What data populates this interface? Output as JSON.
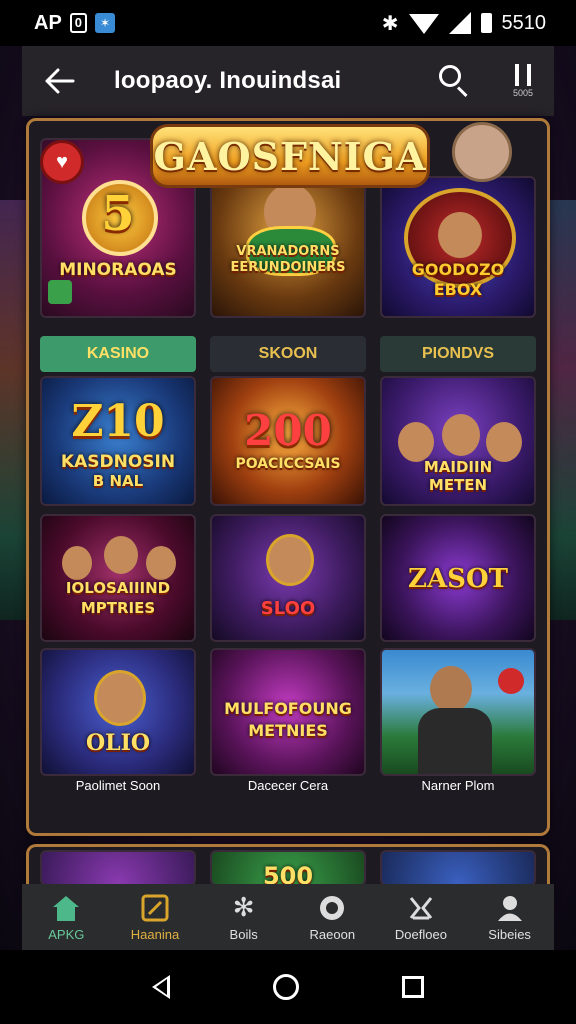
{
  "status_bar": {
    "left_text": "AP",
    "sim_label": "0",
    "bt_label": "✶",
    "time": "5510"
  },
  "header": {
    "title": "loopaoy. Inouindsai",
    "pause_sub": "5005"
  },
  "banner": {
    "title": "GAOSFNIGA"
  },
  "tiles_row1": [
    {
      "text": "MINORAOAS",
      "big": "5"
    },
    {
      "text": "VRANADORNS\nEERUNDOINERS"
    },
    {
      "text": "GOODOZO\nEBOX"
    }
  ],
  "sections": [
    "KASINO",
    "SKOON",
    "PIONDVS"
  ],
  "tiles_row2": [
    {
      "big": "Z10",
      "text": "KASDNOSIN",
      "sub": "B NAL"
    },
    {
      "big": "200",
      "text": "POACICCSAIS"
    },
    {
      "text": "MAIDIIN\nMETEN"
    }
  ],
  "tiles_row3": [
    {
      "text": "IOLOSAIIIND\nMPTRIES"
    },
    {
      "text": "SLOO"
    },
    {
      "text": "ZASOT"
    }
  ],
  "tiles_row4": [
    {
      "text": "OLIO"
    },
    {
      "text": "MULFOFOUNG\nMETNIES"
    },
    {
      "text": ""
    }
  ],
  "captions": [
    "Paolimet Soon",
    "Dacecer Cera",
    "Narner Plom"
  ],
  "tiles_row5": [
    {
      "text": ""
    },
    {
      "text": "500"
    },
    {
      "text": ""
    }
  ],
  "bottom_nav": [
    {
      "label": "APKG",
      "icon": "home-icon"
    },
    {
      "label": "Haanina",
      "icon": "slot-icon"
    },
    {
      "label": "Boils",
      "icon": "spark-icon"
    },
    {
      "label": "Raeoon",
      "icon": "chip-icon"
    },
    {
      "label": "Doefloeo",
      "icon": "chair-icon"
    },
    {
      "label": "Sibeies",
      "icon": "profile-icon"
    }
  ]
}
